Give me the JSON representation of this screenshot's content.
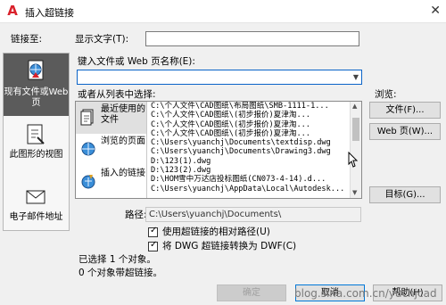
{
  "window": {
    "title": "插入超链接",
    "logo_letter": "A",
    "close_glyph": "✕"
  },
  "link_to_label": "链接至:",
  "sidebar": {
    "items": [
      {
        "label": "现有文件或Web 页",
        "icon": "globe-document-icon",
        "active": true
      },
      {
        "label": "此图形的视图",
        "icon": "drawing-view-icon",
        "active": false
      },
      {
        "label": "电子邮件地址",
        "icon": "email-envelope-icon",
        "active": false
      }
    ]
  },
  "display_text": {
    "label": "显示文字(T):",
    "value": ""
  },
  "file_or_web": {
    "label": "键入文件或 Web 页名称(E):",
    "value": ""
  },
  "list_label": "或者从列表中选择:",
  "categories": [
    {
      "label": "最近使用的文件",
      "icon": "recent-files-icon",
      "active": true
    },
    {
      "label": "浏览的页面",
      "icon": "browsed-pages-icon",
      "active": false
    },
    {
      "label": "插入的链接",
      "icon": "inserted-links-icon",
      "active": false
    }
  ],
  "files": [
    "C:\\个人文件\\CAD图纸\\布局图纸\\SMB-1111-1...",
    "C:\\个人文件\\CAD图纸\\(初步报价)夏津淘...",
    "C:\\个人文件\\CAD图纸\\(初步报价)夏津淘...",
    "C:\\个人文件\\CAD图纸\\(初步报价)夏津淘...",
    "C:\\Users\\yuanchj\\Documents\\textdisp.dwg",
    "C:\\Users\\yuanchj\\Documents\\Drawing3.dwg",
    "D:\\123(1).dwg",
    "D:\\123(2).dwg",
    "D:\\HOM雪中万达店投标图纸(CN073-4-14).d...",
    "C:\\Users\\yuanchj\\AppData\\Local\\Autodesk..."
  ],
  "browse": {
    "label": "浏览:",
    "file_button": "文件(F)...",
    "web_button": "Web 页(W)..."
  },
  "target_button": "目标(G)...",
  "path": {
    "label": "路径:",
    "value": "C:\\Users\\yuanchj\\Documents\\"
  },
  "options": [
    {
      "label": "使用超链接的相对路径(U)",
      "checked": true
    },
    {
      "label": "将 DWG 超链接转换为 DWF(C)",
      "checked": true
    }
  ],
  "status": {
    "selected": "已选择 1 个对象。",
    "with_links": "0 个对象带超链接。"
  },
  "buttons": {
    "ok": "确定",
    "cancel": "取消",
    "help": "帮助(H)"
  },
  "watermark": "blog.sina.com.cn/yuchjcad",
  "colors": {
    "accent": "#0a64c8",
    "sidebar_active": "#5b5b5b",
    "logo_red": "#d9212b"
  }
}
